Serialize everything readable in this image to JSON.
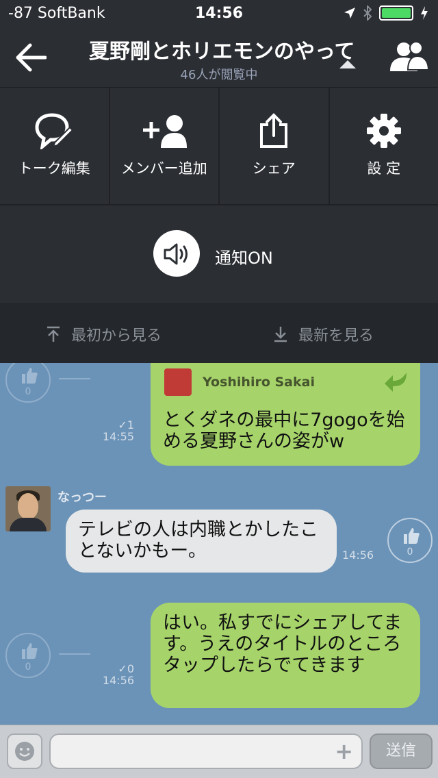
{
  "status_bar": {
    "carrier": "-87 SoftBank",
    "time": "14:56"
  },
  "header": {
    "title": "夏野剛とホリエモンのやって",
    "subtitle": "46人が閲覧中"
  },
  "menu": {
    "talk_edit": "トーク編集",
    "add_member": "メンバー追加",
    "share": "シェア",
    "settings": "設 定",
    "notify": "通知ON"
  },
  "nav": {
    "first": "最初から見る",
    "latest": "最新を見る"
  },
  "chat": {
    "messages": [
      {
        "quote_author": "Yoshihiro Sakai",
        "text": "とくダネの最中に7gogoを始める夏野さんの姿がw",
        "read": "✓1",
        "time": "14:55",
        "likes": "0"
      },
      {
        "sender": "なっつー",
        "text": "テレビの人は内職とかしたことないかもー。",
        "time": "14:56",
        "likes": "0"
      },
      {
        "text": "はい。私すでにシェアしてます。うえのタイトルのところタップしたらでてきます",
        "read": "✓0",
        "time": "14:56",
        "likes": "0"
      }
    ]
  },
  "input": {
    "send_label": "送信",
    "plus": "+"
  },
  "colors": {
    "header_bg": "#2b2e33",
    "chat_bg": "#6b93b8",
    "bubble_green": "#a6d46a",
    "bubble_grey": "#e6e7e8",
    "battery": "#4cd964"
  }
}
